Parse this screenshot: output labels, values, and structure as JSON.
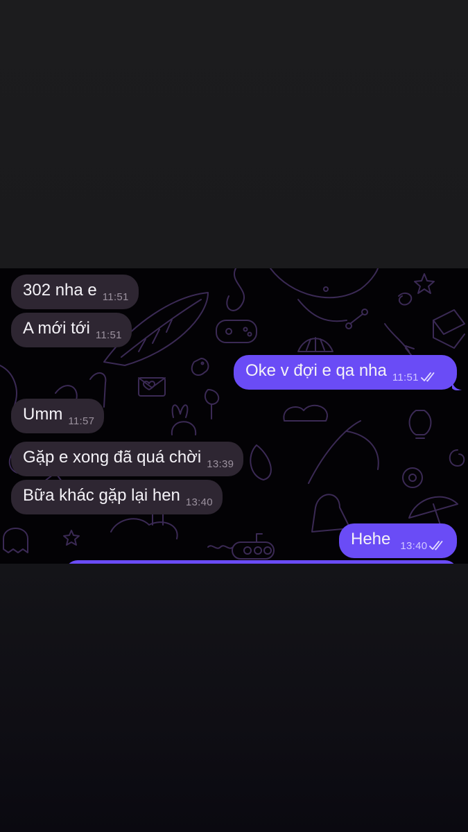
{
  "colors": {
    "incoming_bubble": "#2e2632",
    "outgoing_bubble": "#6a4cf6",
    "chat_background": "#030205",
    "doodle_stroke": "#3b2a55"
  },
  "messages": [
    {
      "direction": "in",
      "text": "302 nha e",
      "time": "11:51"
    },
    {
      "direction": "in",
      "text": "A mới tới",
      "time": "11:51"
    },
    {
      "direction": "out",
      "text": "Oke v đợi e qa nha",
      "time": "11:51",
      "status": "read-double-check-icon"
    },
    {
      "direction": "in",
      "text": "Umm",
      "time": "11:57"
    },
    {
      "direction": "in",
      "text": "Gặp e xong đã quá chời",
      "time": "13:39"
    },
    {
      "direction": "in",
      "text": "Bữa khác gặp lại hen",
      "time": "13:40"
    },
    {
      "direction": "out",
      "text": "Hehe",
      "time": "13:40",
      "status": "read-double-check-icon"
    }
  ]
}
